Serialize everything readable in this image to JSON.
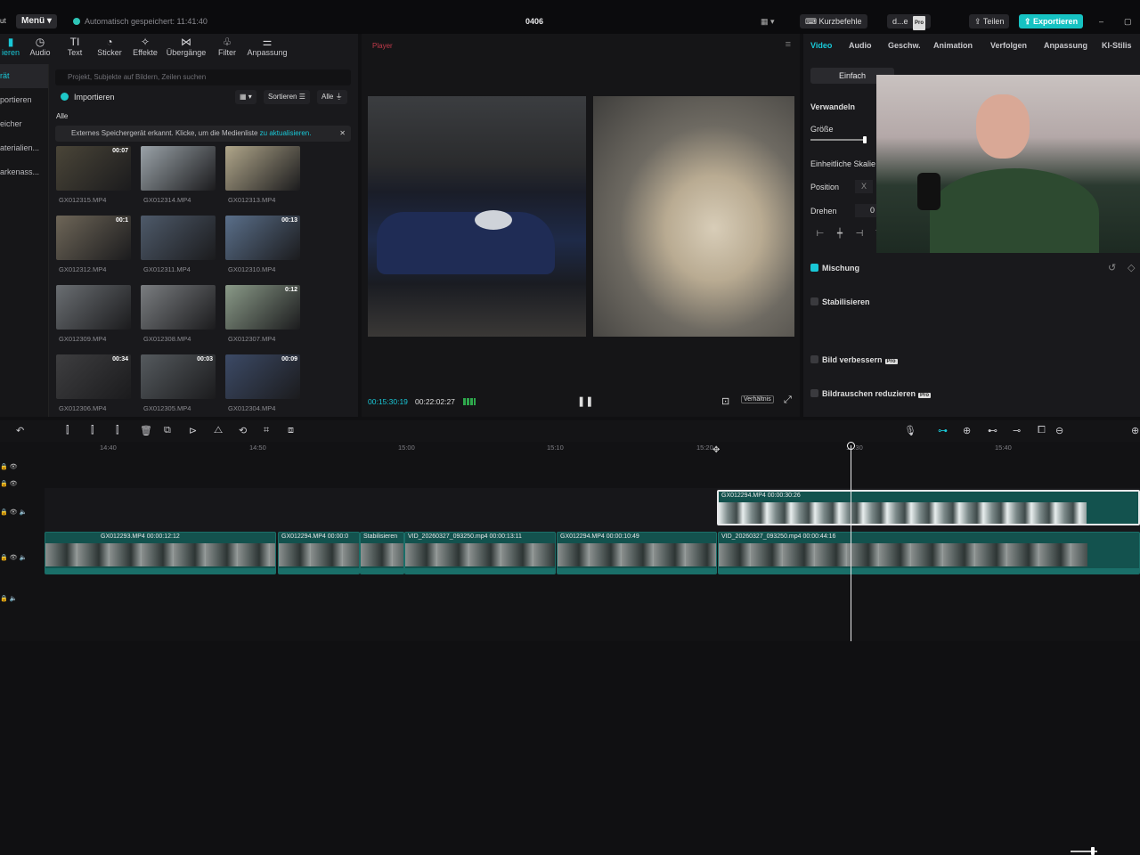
{
  "app": {
    "logo_partial": "ut",
    "menu_label": "Menü",
    "save_status": "Automatisch gespeichert: 11:41:40",
    "project_title": "0406",
    "shortcuts_label": "Kurzbefehle",
    "user_label": "d...e",
    "share_label": "Teilen",
    "export_label": "Exportieren"
  },
  "toolbar": {
    "tabs": [
      {
        "label": "ieren",
        "icon": "import-icon"
      },
      {
        "label": "Audio",
        "icon": "audio-icon"
      },
      {
        "label": "Text",
        "icon": "text-icon"
      },
      {
        "label": "Sticker",
        "icon": "sticker-icon"
      },
      {
        "label": "Effekte",
        "icon": "effects-icon"
      },
      {
        "label": "Übergänge",
        "icon": "transitions-icon"
      },
      {
        "label": "Filter",
        "icon": "filter-icon"
      },
      {
        "label": "Anpassung",
        "icon": "adjust-icon"
      }
    ]
  },
  "leftnav": {
    "items": [
      "rät",
      "portieren",
      "eicher",
      "aterialien...",
      "arkenass..."
    ]
  },
  "media": {
    "search_placeholder": "Projekt, Subjekte auf Bildern, Zeilen suchen",
    "import_label": "Importieren",
    "sort_label": "Sortieren",
    "filter_label": "Alle",
    "all_label": "Alle",
    "notice_text": "Externes Speichergerät erkannt. Klicke, um die Medienliste",
    "notice_link": "zu aktualisieren.",
    "items": [
      {
        "name": "GX012315.MP4",
        "duration": "00:07"
      },
      {
        "name": "GX012314.MP4",
        "duration": ""
      },
      {
        "name": "GX012313.MP4",
        "duration": ""
      },
      {
        "name": "GX012312.MP4",
        "duration": "00:1"
      },
      {
        "name": "GX012311.MP4",
        "duration": ""
      },
      {
        "name": "GX012310.MP4",
        "duration": "00:13"
      },
      {
        "name": "GX012309.MP4",
        "duration": ""
      },
      {
        "name": "GX012308.MP4",
        "duration": ""
      },
      {
        "name": "GX012307.MP4",
        "duration": "0:12"
      },
      {
        "name": "GX012306.MP4",
        "duration": "00:34"
      },
      {
        "name": "GX012305.MP4",
        "duration": "00:03"
      },
      {
        "name": "GX012304.MP4",
        "duration": "00:09"
      }
    ]
  },
  "player": {
    "label": "Player",
    "current_time": "00:15:30:19",
    "total_time": "00:22:02:27",
    "ratio_label": "Verhältnis"
  },
  "inspector": {
    "tabs": [
      "Video",
      "Audio",
      "Geschw.",
      "Animation",
      "Verfolgen",
      "Anpassung",
      "KI-Stilis"
    ],
    "mode": "Einfach",
    "section_transform": "Verwandeln",
    "size_label": "Größe",
    "uniform_scale_label": "Einheitliche Skalie",
    "position_label": "Position",
    "position_x": "X",
    "rotate_label": "Drehen",
    "rotate_value": "0",
    "blend_label": "Mischung",
    "stabilize_label": "Stabilisieren",
    "enhance_label": "Bild verbessern",
    "denoise_label": "Bildrauschen reduzieren",
    "pro_badge": "Pro"
  },
  "timeline": {
    "ticks": [
      "14:40",
      "14:50",
      "15:00",
      "15:10",
      "15:20",
      "15:30",
      "15:40"
    ],
    "overlay_clip": {
      "label": "GX012294.MP4  00:00:30:26"
    },
    "main_clips": [
      {
        "label": "GX012293.MP4  00:00:12:12"
      },
      {
        "label": "GX012294.MP4  00:00:0"
      },
      {
        "label": "Stabilisieren"
      },
      {
        "label": "VID_20260327_093250.mp4  00:00:13:11"
      },
      {
        "label": "GX012294.MP4  00:00:10:49"
      },
      {
        "label": "VID_20260327_093250.mp4  00:00:44:16"
      }
    ]
  },
  "colors": {
    "accent": "#19c7d6",
    "clip": "#13524e",
    "export": "#16c2c2"
  }
}
